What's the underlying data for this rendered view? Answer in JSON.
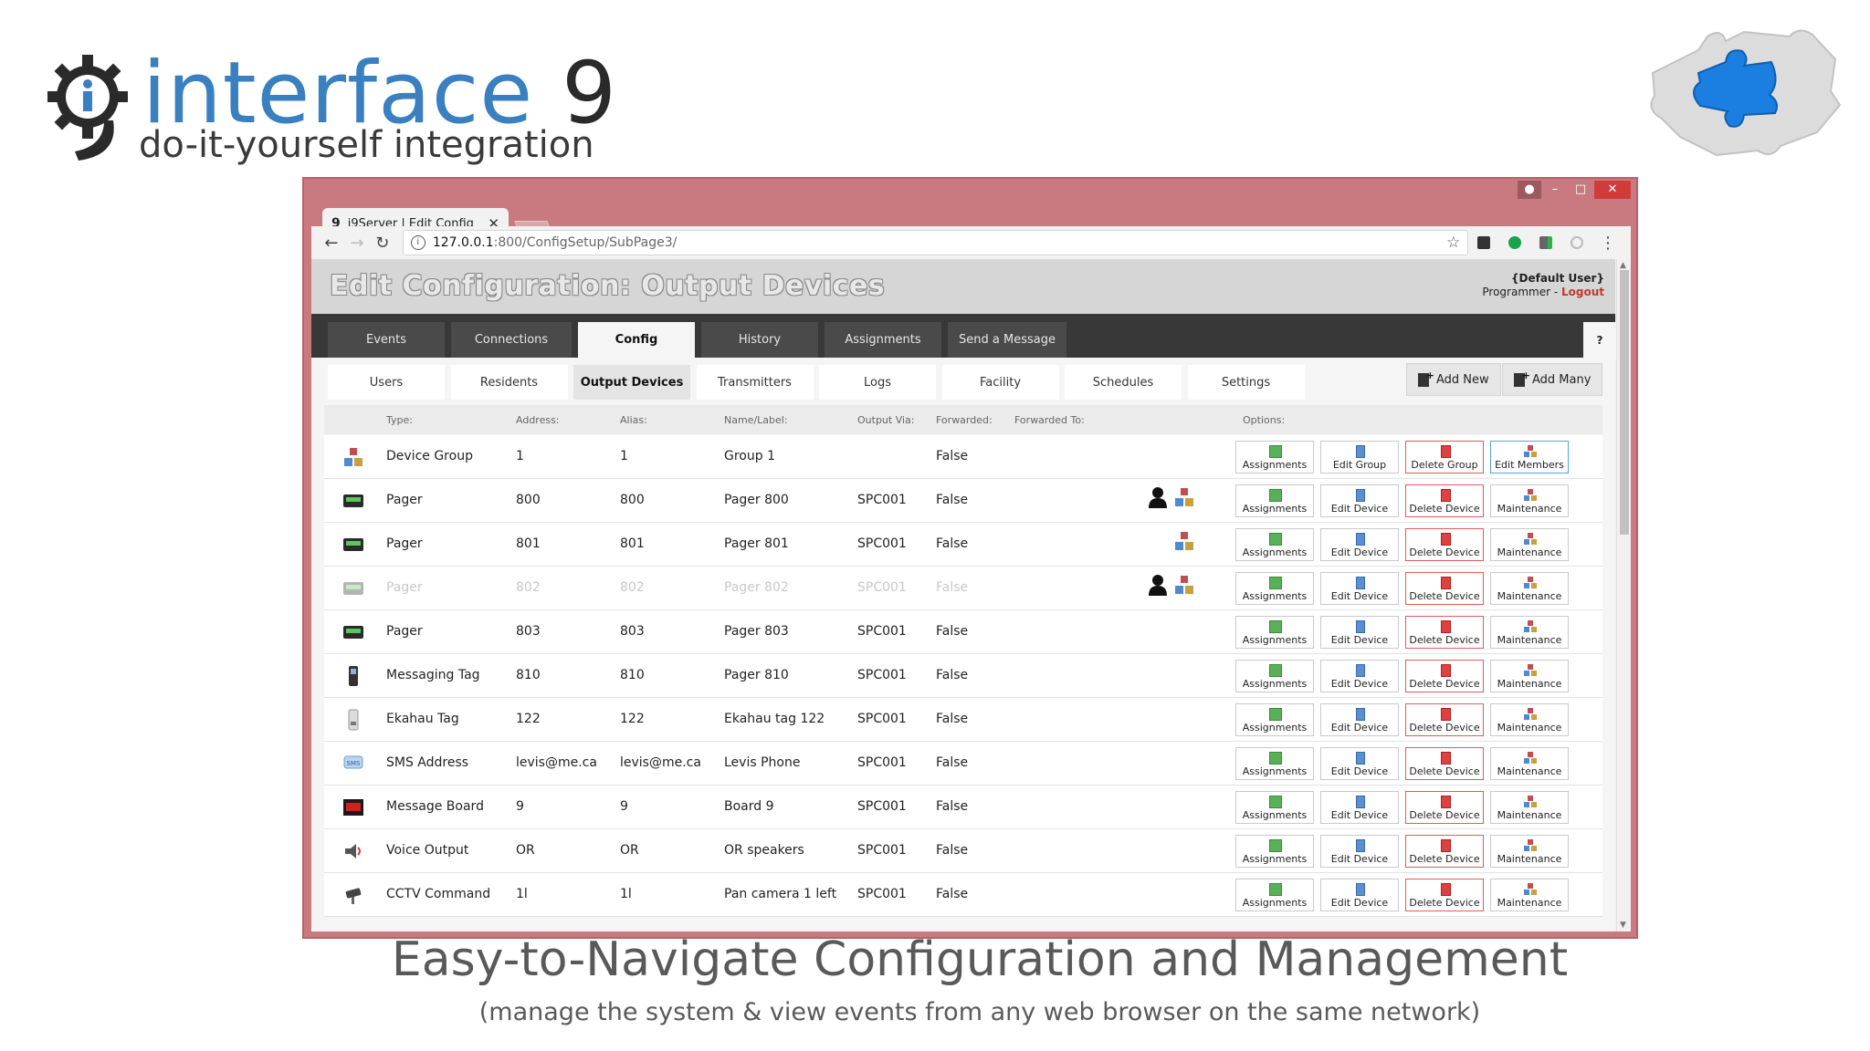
{
  "logo": {
    "word": "interface",
    "number": "9",
    "tagline": "do-it-yourself integration"
  },
  "caption": {
    "title": "Easy-to-Navigate Configuration and Management",
    "subtitle": "(manage the system & view events from any web browser on the same network)"
  },
  "browser": {
    "tab_title": "i9Server | Edit Config",
    "url": "127.0.0.1:800/ConfigSetup/SubPage3/",
    "url_host": "127.0.0.1",
    "url_rest": ":800/ConfigSetup/SubPage3/"
  },
  "app": {
    "title": "Edit Configuration: Output Devices",
    "user": "{Default User}",
    "role": "Programmer",
    "role_sep": " - ",
    "logout": "Logout",
    "help": "?",
    "main_tabs": [
      "Events",
      "Connections",
      "Config",
      "History",
      "Assignments",
      "Send a Message"
    ],
    "active_main_tab": "Config",
    "sub_tabs": [
      "Users",
      "Residents",
      "Output Devices",
      "Transmitters",
      "Logs",
      "Facility",
      "Schedules",
      "Settings"
    ],
    "active_sub_tab": "Output Devices",
    "add_new": "Add New",
    "add_many": "Add Many"
  },
  "table": {
    "headers": [
      "Type:",
      "Address:",
      "Alias:",
      "Name/Label:",
      "Output Via:",
      "Forwarded:",
      "Forwarded To:",
      "Options:"
    ],
    "rows": [
      {
        "icon": "device-group-icon",
        "type": "Device Group",
        "address": "1",
        "alias": "1",
        "name": "Group 1",
        "via": "",
        "forwarded": "False",
        "fwd_icons": [],
        "dim": false,
        "options": [
          "Assignments",
          "Edit Group",
          "Delete Group",
          "Edit Members"
        ]
      },
      {
        "icon": "pager-icon",
        "type": "Pager",
        "address": "800",
        "alias": "800",
        "name": "Pager 800",
        "via": "SPC001",
        "forwarded": "False",
        "fwd_icons": [
          "person-icon",
          "group-icon"
        ],
        "dim": false,
        "options": [
          "Assignments",
          "Edit Device",
          "Delete Device",
          "Maintenance"
        ]
      },
      {
        "icon": "pager-icon",
        "type": "Pager",
        "address": "801",
        "alias": "801",
        "name": "Pager 801",
        "via": "SPC001",
        "forwarded": "False",
        "fwd_icons": [
          "group-icon"
        ],
        "dim": false,
        "options": [
          "Assignments",
          "Edit Device",
          "Delete Device",
          "Maintenance"
        ]
      },
      {
        "icon": "pager-icon",
        "type": "Pager",
        "address": "802",
        "alias": "802",
        "name": "Pager 802",
        "via": "SPC001",
        "forwarded": "False",
        "fwd_icons": [
          "person-icon",
          "group-icon"
        ],
        "dim": true,
        "options": [
          "Assignments",
          "Edit Device",
          "Delete Device",
          "Maintenance"
        ]
      },
      {
        "icon": "pager-icon",
        "type": "Pager",
        "address": "803",
        "alias": "803",
        "name": "Pager 803",
        "via": "SPC001",
        "forwarded": "False",
        "fwd_icons": [],
        "dim": false,
        "options": [
          "Assignments",
          "Edit Device",
          "Delete Device",
          "Maintenance"
        ]
      },
      {
        "icon": "messaging-tag-icon",
        "type": "Messaging Tag",
        "address": "810",
        "alias": "810",
        "name": "Pager 810",
        "via": "SPC001",
        "forwarded": "False",
        "fwd_icons": [],
        "dim": false,
        "options": [
          "Assignments",
          "Edit Device",
          "Delete Device",
          "Maintenance"
        ]
      },
      {
        "icon": "ekahau-tag-icon",
        "type": "Ekahau Tag",
        "address": "122",
        "alias": "122",
        "name": "Ekahau tag 122",
        "via": "SPC001",
        "forwarded": "False",
        "fwd_icons": [],
        "dim": false,
        "options": [
          "Assignments",
          "Edit Device",
          "Delete Device",
          "Maintenance"
        ]
      },
      {
        "icon": "sms-icon",
        "type": "SMS Address",
        "address": "levis@me.ca",
        "alias": "levis@me.ca",
        "name": "Levis Phone",
        "via": "SPC001",
        "forwarded": "False",
        "fwd_icons": [],
        "dim": false,
        "options": [
          "Assignments",
          "Edit Device",
          "Delete Device",
          "Maintenance"
        ]
      },
      {
        "icon": "message-board-icon",
        "type": "Message Board",
        "address": "9",
        "alias": "9",
        "name": "Board 9",
        "via": "SPC001",
        "forwarded": "False",
        "fwd_icons": [],
        "dim": false,
        "options": [
          "Assignments",
          "Edit Device",
          "Delete Device",
          "Maintenance"
        ]
      },
      {
        "icon": "voice-output-icon",
        "type": "Voice Output",
        "address": "OR",
        "alias": "OR",
        "name": "OR speakers",
        "via": "SPC001",
        "forwarded": "False",
        "fwd_icons": [],
        "dim": false,
        "options": [
          "Assignments",
          "Edit Device",
          "Delete Device",
          "Maintenance"
        ]
      },
      {
        "icon": "cctv-icon",
        "type": "CCTV Command",
        "address": "1l",
        "alias": "1l",
        "name": "Pan camera 1 left",
        "via": "SPC001",
        "forwarded": "False",
        "fwd_icons": [],
        "dim": false,
        "options": [
          "Assignments",
          "Edit Device",
          "Delete Device",
          "Maintenance"
        ]
      }
    ]
  },
  "colors": {
    "brand_blue": "#3a7fc0",
    "window_frame": "#c97a80",
    "nav_dark": "#383838",
    "delete_red": "#e05a5a",
    "members_blue": "#5aa0d8"
  }
}
